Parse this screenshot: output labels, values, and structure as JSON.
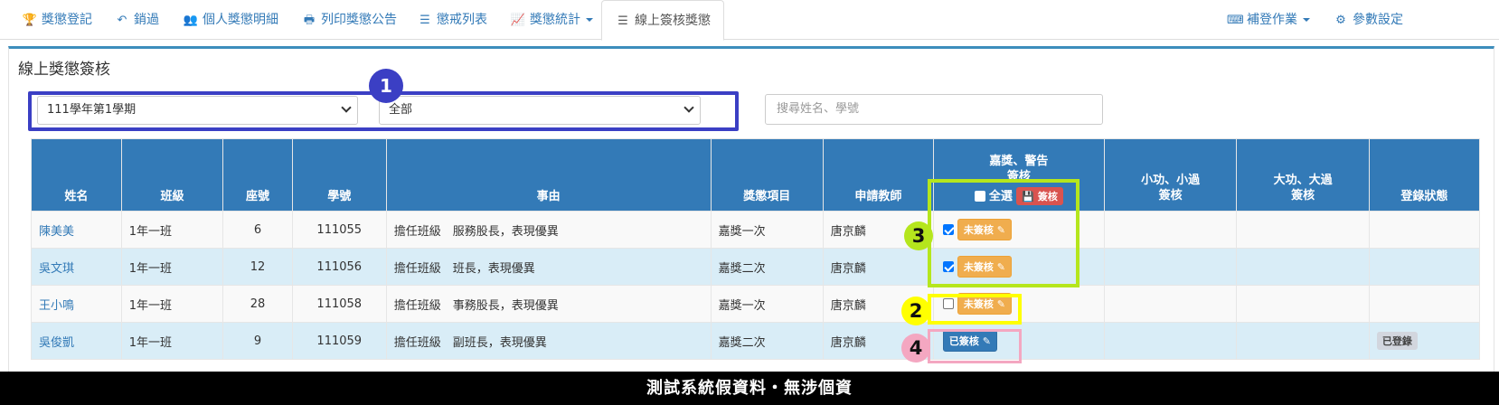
{
  "nav": {
    "items": [
      {
        "icon": "trophy-icon",
        "glyph": "🏆",
        "label": "獎懲登記"
      },
      {
        "icon": "undo-icon",
        "glyph": "↶",
        "label": "銷過"
      },
      {
        "icon": "users-icon",
        "glyph": "👥",
        "label": "個人獎懲明細"
      },
      {
        "icon": "print-icon",
        "glyph": "🖶",
        "label": "列印獎懲公告"
      },
      {
        "icon": "list-icon",
        "glyph": "☰",
        "label": "懲戒列表"
      },
      {
        "icon": "chart-icon",
        "glyph": "📈",
        "label": "獎懲統計"
      },
      {
        "icon": "list-icon",
        "glyph": "☰",
        "label": "線上簽核獎懲"
      }
    ],
    "right": [
      {
        "icon": "keyboard-icon",
        "glyph": "⌨",
        "label": "補登作業"
      },
      {
        "icon": "gear-icon",
        "glyph": "⚙",
        "label": "參數設定"
      }
    ]
  },
  "panel": {
    "title": "線上獎懲簽核",
    "semester": "111學年第1學期",
    "filter": "全部",
    "search_placeholder": "搜尋姓名、學號"
  },
  "table": {
    "headers": {
      "name": "姓名",
      "class": "班級",
      "seat": "座號",
      "student_id": "學號",
      "reason": "事由",
      "item": "獎懲項目",
      "teacher": "申請教師",
      "sign1_l1": "嘉獎、警告",
      "sign1_l2": "簽核",
      "select_all": "全選",
      "sign_btn": "簽核",
      "sign2_l1": "小功、小過",
      "sign2_l2": "簽核",
      "sign3_l1": "大功、大過",
      "sign3_l2": "簽核",
      "status": "登錄狀態"
    },
    "rows": [
      {
        "name": "陳美美",
        "class": "1年一班",
        "seat": "6",
        "sid": "111055",
        "reason": "擔任班級　服務股長，表現優異",
        "item": "嘉獎一次",
        "teacher": "唐京麟",
        "checked": true,
        "sign": "未簽核",
        "status": ""
      },
      {
        "name": "吳文琪",
        "class": "1年一班",
        "seat": "12",
        "sid": "111056",
        "reason": "擔任班級　班長，表現優異",
        "item": "嘉獎二次",
        "teacher": "唐京麟",
        "checked": true,
        "sign": "未簽核",
        "status": ""
      },
      {
        "name": "王小鳴",
        "class": "1年一班",
        "seat": "28",
        "sid": "111058",
        "reason": "擔任班級　事務股長，表現優異",
        "item": "嘉獎一次",
        "teacher": "唐京麟",
        "checked": false,
        "sign": "未簽核",
        "status": ""
      },
      {
        "name": "吳俊凱",
        "class": "1年一班",
        "seat": "9",
        "sid": "111059",
        "reason": "擔任班級　副班長，表現優異",
        "item": "嘉獎二次",
        "teacher": "唐京麟",
        "checked": null,
        "sign": "已簽核",
        "status": "已登錄"
      }
    ]
  },
  "annotations": {
    "n1": "1",
    "n2": "2",
    "n3": "3",
    "n4": "4",
    "colors": {
      "n1": "#3b3fc4",
      "n2": "#ffff00",
      "n3": "#b5e61d",
      "n4": "#f4a7c1"
    }
  },
  "footer": "測試系統假資料・無涉個資"
}
